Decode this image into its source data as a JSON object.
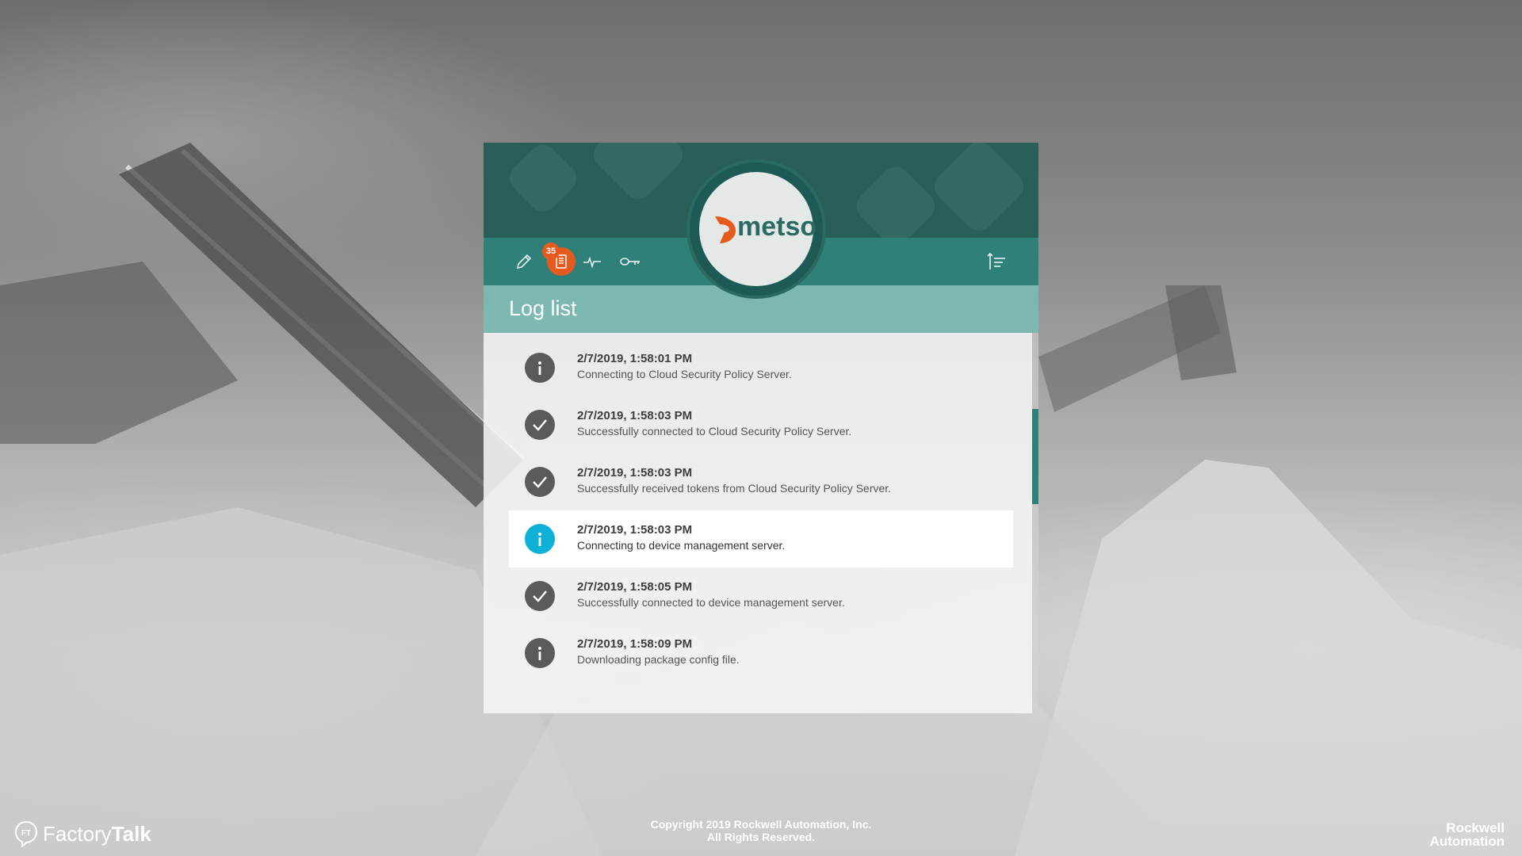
{
  "panel": {
    "title": "Log list",
    "brand": "metso",
    "badge_count": "35"
  },
  "toolbar": {
    "icons": [
      "pencil-icon",
      "log-list-icon",
      "pulse-icon",
      "key-icon",
      "sort-icon"
    ],
    "active": "log-list-icon"
  },
  "log_entries": [
    {
      "timestamp": "2/7/2019, 1:58:01 PM",
      "message": "Connecting to Cloud Security Policy Server.",
      "status": "info"
    },
    {
      "timestamp": "2/7/2019, 1:58:03 PM",
      "message": "Successfully connected to Cloud Security Policy Server.",
      "status": "success"
    },
    {
      "timestamp": "2/7/2019, 1:58:03 PM",
      "message": "Successfully received tokens from Cloud Security Policy Server.",
      "status": "success"
    },
    {
      "timestamp": "2/7/2019, 1:58:03 PM",
      "message": "Connecting to device management server.",
      "status": "info-selected"
    },
    {
      "timestamp": "2/7/2019, 1:58:05 PM",
      "message": "Successfully connected to device management server.",
      "status": "success"
    },
    {
      "timestamp": "2/7/2019, 1:58:09 PM",
      "message": "Downloading package config file.",
      "status": "info"
    }
  ],
  "footer": {
    "copyright_line1": "Copyright 2019 Rockwell Automation, Inc.",
    "copyright_line2": "All Rights Reserved.",
    "factorytalk_prefix": "Factory",
    "factorytalk_suffix": "Talk",
    "ft_badge": "FT",
    "rockwell_line1": "Rockwell",
    "rockwell_line2": "Automation"
  },
  "colors": {
    "header": "#2a5f59",
    "toolbar": "#2e8079",
    "accent": "#e65a1e",
    "info_active": "#0fb0d8"
  }
}
